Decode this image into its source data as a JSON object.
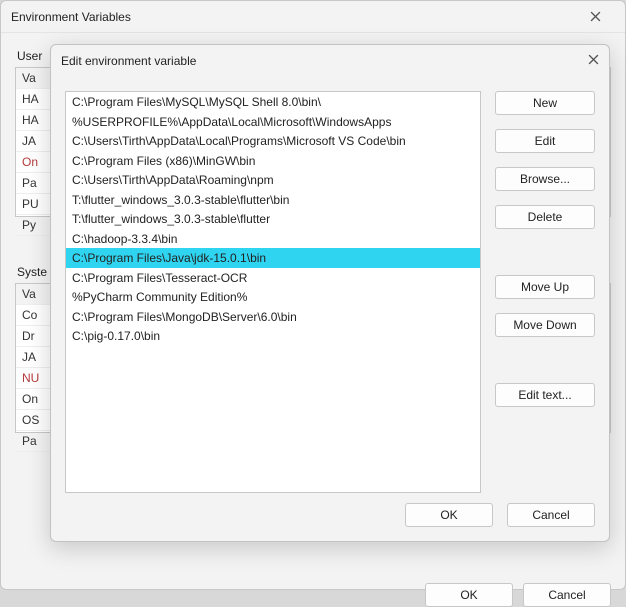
{
  "outer": {
    "title": "Environment Variables",
    "group_user_label": "User",
    "group_system_label": "Syste",
    "user_vars_header": "Va",
    "user_vars": [
      {
        "label": "HA",
        "red": false
      },
      {
        "label": "HA",
        "red": false
      },
      {
        "label": "JA",
        "red": false
      },
      {
        "label": "On",
        "red": true
      },
      {
        "label": "Pa",
        "red": false
      },
      {
        "label": "PU",
        "red": false
      },
      {
        "label": "Py",
        "red": false
      }
    ],
    "system_vars_header": "Va",
    "system_vars": [
      {
        "label": "Co",
        "red": false
      },
      {
        "label": "Dr",
        "red": false
      },
      {
        "label": "JA",
        "red": false
      },
      {
        "label": "NU",
        "red": true
      },
      {
        "label": "On",
        "red": false
      },
      {
        "label": "OS",
        "red": false
      },
      {
        "label": "Pa",
        "red": false
      }
    ],
    "ok": "OK",
    "cancel": "Cancel"
  },
  "inner": {
    "title": "Edit environment variable",
    "entries": [
      "C:\\Program Files\\MySQL\\MySQL Shell 8.0\\bin\\",
      "%USERPROFILE%\\AppData\\Local\\Microsoft\\WindowsApps",
      "C:\\Users\\Tirth\\AppData\\Local\\Programs\\Microsoft VS Code\\bin",
      "C:\\Program Files (x86)\\MinGW\\bin",
      "C:\\Users\\Tirth\\AppData\\Roaming\\npm",
      "T:\\flutter_windows_3.0.3-stable\\flutter\\bin",
      "T:\\flutter_windows_3.0.3-stable\\flutter",
      "C:\\hadoop-3.3.4\\bin",
      "C:\\Program Files\\Java\\jdk-15.0.1\\bin",
      "C:\\Program Files\\Tesseract-OCR",
      "%PyCharm Community Edition%",
      "C:\\Program Files\\MongoDB\\Server\\6.0\\bin",
      "C:\\pig-0.17.0\\bin"
    ],
    "selected_index": 8,
    "buttons": {
      "new": "New",
      "edit": "Edit",
      "browse": "Browse...",
      "delete": "Delete",
      "moveup": "Move Up",
      "movedown": "Move Down",
      "edittext": "Edit text..."
    },
    "ok": "OK",
    "cancel": "Cancel"
  }
}
